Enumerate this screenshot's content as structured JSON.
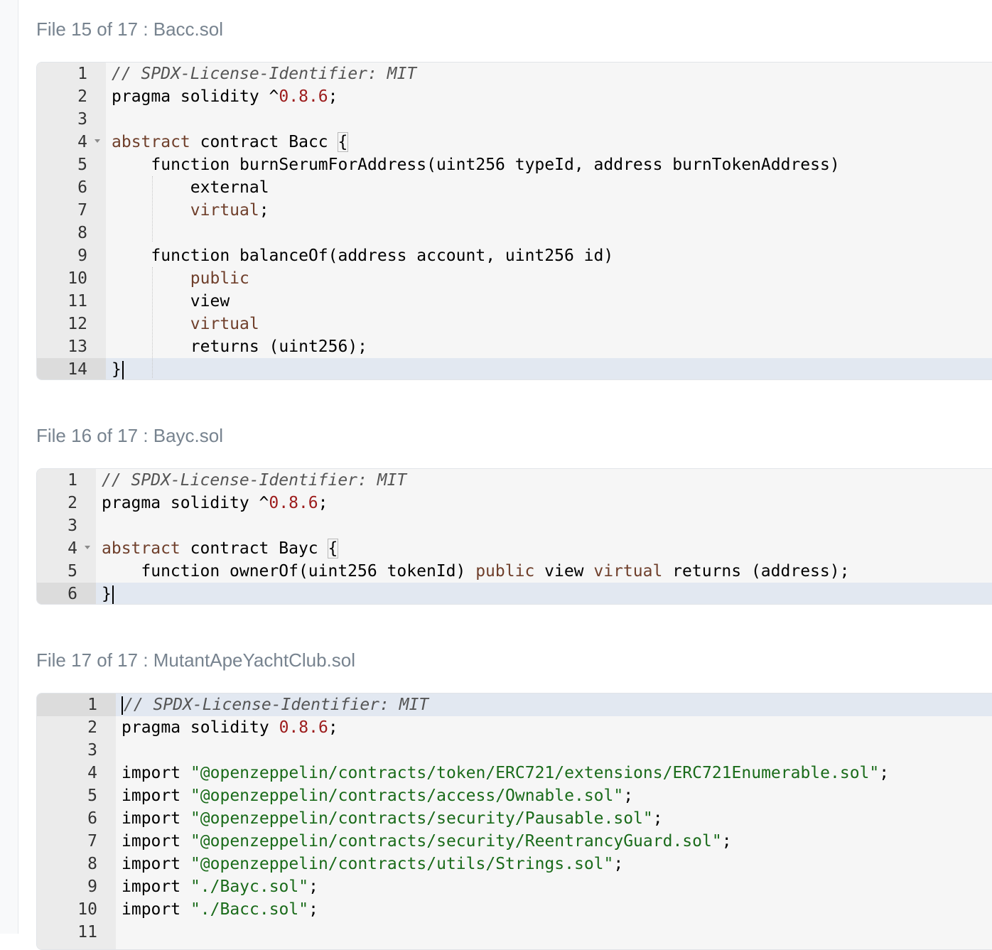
{
  "files": [
    {
      "title": "File 15 of 17 : Bacc.sol",
      "lines": [
        {
          "n": "1",
          "html": "<span class=\"c-comment\">// SPDX-License-Identifier: MIT</span>"
        },
        {
          "n": "2",
          "html": "pragma solidity ^<span class=\"c-num\">0.8.6</span>;"
        },
        {
          "n": "3",
          "html": ""
        },
        {
          "n": "4",
          "html": "<span class=\"c-kw\">abstract</span> contract Bacc <span class=\"bracket\">{</span>"
        },
        {
          "n": "5",
          "html": "    function burnSerumForAddress(uint256 typeId, address burnTokenAddress)"
        },
        {
          "n": "6",
          "html": "        external"
        },
        {
          "n": "7",
          "html": "        <span class=\"c-kw\">virtual</span>;"
        },
        {
          "n": "8",
          "html": ""
        },
        {
          "n": "9",
          "html": "    function balanceOf(address account, uint256 id)"
        },
        {
          "n": "10",
          "html": "        <span class=\"c-kw\">public</span>"
        },
        {
          "n": "11",
          "html": "        view"
        },
        {
          "n": "12",
          "html": "        <span class=\"c-kw\">virtual</span>"
        },
        {
          "n": "13",
          "html": "        returns (uint256);"
        },
        {
          "n": "14",
          "html": "}"
        }
      ]
    },
    {
      "title": "File 16 of 17 : Bayc.sol",
      "lines": [
        {
          "n": "1",
          "html": "<span class=\"c-comment\">// SPDX-License-Identifier: MIT</span>"
        },
        {
          "n": "2",
          "html": "pragma solidity ^<span class=\"c-num\">0.8.6</span>;"
        },
        {
          "n": "3",
          "html": ""
        },
        {
          "n": "4",
          "html": "<span class=\"c-kw\">abstract</span> contract Bayc <span class=\"bracket\">{</span>"
        },
        {
          "n": "5",
          "html": "    function ownerOf(uint256 tokenId) <span class=\"c-kw\">public</span> view <span class=\"c-kw\">virtual</span> returns (address);"
        },
        {
          "n": "6",
          "html": "}"
        }
      ]
    },
    {
      "title": "File 17 of 17 : MutantApeYachtClub.sol",
      "lines": [
        {
          "n": "1",
          "html": "<span class=\"c-comment\">// SPDX-License-Identifier: MIT</span>"
        },
        {
          "n": "2",
          "html": "pragma solidity <span class=\"c-num\">0.8.6</span>;"
        },
        {
          "n": "3",
          "html": ""
        },
        {
          "n": "4",
          "html": "import <span class=\"c-str\">\"@openzeppelin/contracts/token/ERC721/extensions/ERC721Enumerable.sol\"</span>;"
        },
        {
          "n": "5",
          "html": "import <span class=\"c-str\">\"@openzeppelin/contracts/access/Ownable.sol\"</span>;"
        },
        {
          "n": "6",
          "html": "import <span class=\"c-str\">\"@openzeppelin/contracts/security/Pausable.sol\"</span>;"
        },
        {
          "n": "7",
          "html": "import <span class=\"c-str\">\"@openzeppelin/contracts/security/ReentrancyGuard.sol\"</span>;"
        },
        {
          "n": "8",
          "html": "import <span class=\"c-str\">\"@openzeppelin/contracts/utils/Strings.sol\"</span>;"
        },
        {
          "n": "9",
          "html": "import <span class=\"c-str\">\"./Bayc.sol\"</span>;"
        },
        {
          "n": "10",
          "html": "import <span class=\"c-str\">\"./Bacc.sol\"</span>;"
        },
        {
          "n": "11",
          "html": ""
        }
      ]
    }
  ]
}
